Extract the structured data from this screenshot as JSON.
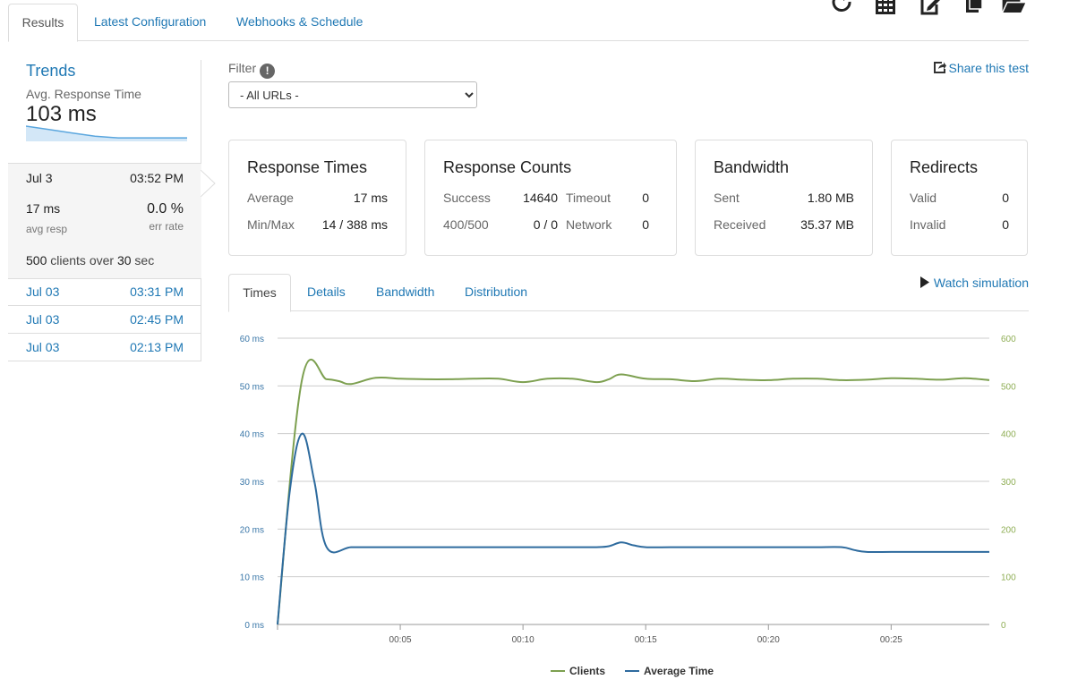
{
  "tabs": [
    {
      "label": "Results"
    },
    {
      "label": "Latest Configuration"
    },
    {
      "label": "Webhooks & Schedule"
    }
  ],
  "toolbar_icons": [
    "refresh-icon",
    "calculator-icon",
    "edit-icon",
    "copy-icon",
    "folder-open-icon"
  ],
  "sidebar": {
    "trends_title": "Trends",
    "avg_label": "Avg. Response Time",
    "avg_value": "103 ms",
    "sparkline_values": [
      450,
      350,
      250,
      150,
      103,
      103,
      103,
      103
    ],
    "current": {
      "date": "Jul 3",
      "time": "03:52 PM",
      "avg_resp": "17 ms",
      "avg_resp_label": "avg resp",
      "err_rate": "0.0 %",
      "err_rate_label": "err rate",
      "clients": "500",
      "clients_text": "clients over",
      "duration": "30",
      "duration_unit": "sec"
    },
    "history": [
      {
        "date": "Jul 03",
        "time": "03:31 PM"
      },
      {
        "date": "Jul 03",
        "time": "02:45 PM"
      },
      {
        "date": "Jul 03",
        "time": "02:13 PM"
      }
    ]
  },
  "filter": {
    "label": "Filter",
    "info_glyph": "!",
    "selected": "- All URLs -"
  },
  "share_label": "Share this test",
  "cards": {
    "response_times": {
      "title": "Response Times",
      "average_label": "Average",
      "average": "17 ms",
      "minmax_label": "Min/Max",
      "minmax": "14 / 388 ms"
    },
    "response_counts": {
      "title": "Response Counts",
      "success_label": "Success",
      "success": "14640",
      "timeout_label": "Timeout",
      "timeout": "0",
      "e400_500_label": "400/500",
      "e400_500": "0 / 0",
      "network_label": "Network",
      "network": "0"
    },
    "bandwidth": {
      "title": "Bandwidth",
      "sent_label": "Sent",
      "sent": "1.80 MB",
      "received_label": "Received",
      "received": "35.37 MB"
    },
    "redirects": {
      "title": "Redirects",
      "valid_label": "Valid",
      "valid": "0",
      "invalid_label": "Invalid",
      "invalid": "0"
    }
  },
  "chart_tabs": [
    {
      "label": "Times"
    },
    {
      "label": "Details"
    },
    {
      "label": "Bandwidth"
    },
    {
      "label": "Distribution"
    }
  ],
  "watch_label": "Watch simulation",
  "colors": {
    "link": "#1f78b4",
    "clients": "#7da050",
    "average_time": "#2e6b9e",
    "left_axis": "#3a77a8",
    "right_axis": "#8fae55"
  },
  "chart_data": {
    "type": "line",
    "x_ticks": [
      "00:05",
      "00:10",
      "00:15",
      "00:20",
      "00:25"
    ],
    "x_tick_seconds": [
      5,
      10,
      15,
      20,
      25
    ],
    "xlim": [
      0,
      29
    ],
    "left_axis": {
      "ticks": [
        "0 ms",
        "10 ms",
        "20 ms",
        "30 ms",
        "40 ms",
        "50 ms",
        "60 ms"
      ],
      "ylim": [
        0,
        60
      ]
    },
    "right_axis": {
      "ticks": [
        "0",
        "100",
        "200",
        "300",
        "400",
        "500",
        "600"
      ],
      "ylim": [
        0,
        600
      ]
    },
    "grid": true,
    "legend_position": "bottom",
    "series": [
      {
        "name": "Clients",
        "axis": "right",
        "x": [
          0,
          1,
          2,
          2.5,
          3,
          4,
          5,
          6,
          7,
          8,
          9,
          10,
          11,
          12,
          13,
          13.5,
          14,
          15,
          16,
          17,
          18,
          19,
          20,
          21,
          22,
          23,
          24,
          25,
          26,
          27,
          28,
          29
        ],
        "y": [
          0,
          514,
          514,
          510,
          504,
          517,
          515,
          514,
          514,
          515,
          515,
          508,
          515,
          515,
          508,
          514,
          524,
          515,
          514,
          510,
          515,
          513,
          512,
          515,
          515,
          512,
          513,
          516,
          515,
          513,
          516,
          512
        ]
      },
      {
        "name": "Average Time",
        "axis": "left",
        "x": [
          0,
          0.5,
          1,
          1.5,
          2,
          3,
          4,
          5,
          6,
          7,
          8,
          9,
          10,
          11,
          12,
          13,
          13.5,
          14,
          14.5,
          15,
          16,
          17,
          18,
          19,
          20,
          21,
          22,
          23,
          23.5,
          24,
          25,
          26,
          27,
          28,
          29
        ],
        "y": [
          0,
          28,
          40,
          30,
          16.2,
          16.2,
          16.2,
          16.2,
          16.2,
          16.2,
          16.2,
          16.2,
          16.2,
          16.2,
          16.2,
          16.2,
          16.4,
          17.2,
          16.6,
          16.2,
          16.2,
          16.2,
          16.2,
          16.2,
          16.2,
          16.2,
          16.2,
          16.2,
          15.6,
          15.2,
          15.2,
          15.2,
          15.2,
          15.2,
          15.2
        ]
      }
    ]
  }
}
